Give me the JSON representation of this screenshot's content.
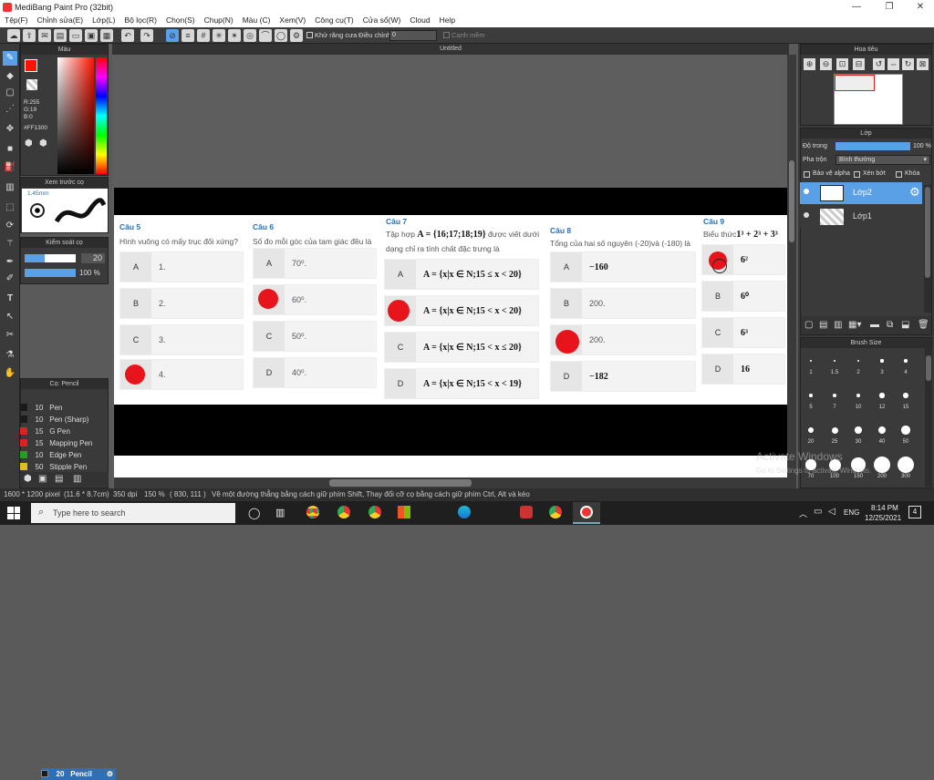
{
  "window": {
    "title": "MediBang Paint Pro (32bit)",
    "min": "—",
    "max": "❐",
    "close": "✕"
  },
  "menu": [
    "Tệp(F)",
    "Chỉnh sửa(E)",
    "Lớp(L)",
    "Bộ lọc(R)",
    "Chọn(S)",
    "Chụp(N)",
    "Màu (C)",
    "Xem(V)",
    "Công cụ(T)",
    "Cửa sổ(W)",
    "Cloud",
    "Help"
  ],
  "toolbar": {
    "antialias_label": "Khử răng cưa",
    "correction_label": "Điều chỉnh",
    "correction_value": "0",
    "snap_label": "Cạnh mềm"
  },
  "color_panel": {
    "title": "Màu",
    "r": "R:255",
    "g": "G:19",
    "b": "B:0",
    "hex": "#FF1300",
    "primary_color": "#ff1300"
  },
  "brush_preview": {
    "title": "Xem trước cọ",
    "size": "1.45mm"
  },
  "control_panel": {
    "title": "Kiểm soát cọ",
    "size": "20",
    "opacity": "100 %"
  },
  "brush_list": {
    "title": "Cọ: Pencil",
    "items": [
      {
        "size": "20",
        "name": "Pencil",
        "color": "#1a1a1a",
        "selected": true
      },
      {
        "size": "10",
        "name": "Pen",
        "color": "#1a1a1a"
      },
      {
        "size": "10",
        "name": "Pen (Sharp)",
        "color": "#1a1a1a"
      },
      {
        "size": "15",
        "name": "G Pen",
        "color": "#e02020"
      },
      {
        "size": "15",
        "name": "Mapping Pen",
        "color": "#e02020"
      },
      {
        "size": "10",
        "name": "Edge Pen",
        "color": "#20a020"
      },
      {
        "size": "50",
        "name": "Stipple Pen",
        "color": "#e0c020"
      }
    ]
  },
  "canvas": {
    "tab_title": "Untitled"
  },
  "questions": [
    {
      "head": "Câu 5",
      "text": "Hình vuông có mấy trục đối xứng?",
      "options": [
        [
          "A",
          "1."
        ],
        [
          "B",
          "2."
        ],
        [
          "C",
          "3."
        ],
        [
          "D",
          "4."
        ]
      ]
    },
    {
      "head": "Câu 6",
      "text": "Số đo mỗi góc của tam giác đều là",
      "options": [
        [
          "A",
          "70⁰."
        ],
        [
          "B",
          "60⁰."
        ],
        [
          "C",
          "50⁰."
        ],
        [
          "D",
          "40⁰."
        ]
      ]
    },
    {
      "head": "Câu 7",
      "text_a": "Tập hợp",
      "text_math": "A = {16;17;18;19}",
      "text_b": "được viết dưới",
      "text_c": "dạng chỉ ra tính chất đặc trưng là",
      "options": [
        [
          "A",
          "A = {x|x ∈ N;15 ≤ x < 20}"
        ],
        [
          "B",
          "A = {x|x ∈ N;15 < x < 20}"
        ],
        [
          "C",
          "A = {x|x ∈ N;15 < x ≤ 20}"
        ],
        [
          "D",
          "A = {x|x ∈ N;15 < x < 19}"
        ]
      ]
    },
    {
      "head": "Câu 8",
      "text": "Tổng của hai số nguyên (-20)và (-180) là",
      "options": [
        [
          "A",
          "−160"
        ],
        [
          "B",
          "200."
        ],
        [
          "C",
          "200."
        ],
        [
          "D",
          "−182"
        ]
      ]
    },
    {
      "head": "Câu 9",
      "text_a": "Biểu thức",
      "text_math": "1³ + 2³ + 3³",
      "options": [
        [
          "A",
          "6²"
        ],
        [
          "B",
          "6⁰"
        ],
        [
          "C",
          "6³"
        ],
        [
          "D",
          "16"
        ]
      ]
    }
  ],
  "navigator": {
    "title": "Hoa tiêu"
  },
  "layers": {
    "title": "Lớp",
    "opacity_label": "Độ trong",
    "opacity_value": "100 %",
    "blend_label": "Pha trộn",
    "blend_value": "Bình thường",
    "protect_alpha": "Bảo vệ alpha",
    "clipping": "Xén bớt",
    "lock": "Khóa",
    "items": [
      {
        "name": "Lớp2",
        "selected": true
      },
      {
        "name": "Lớp1",
        "selected": false
      }
    ]
  },
  "brush_size": {
    "title": "Brush Size",
    "labels": [
      "1",
      "1.5",
      "2",
      "3",
      "4",
      "5",
      "7",
      "10",
      "12",
      "15",
      "20",
      "25",
      "30",
      "40",
      "50",
      "70",
      "100",
      "150",
      "200",
      "300"
    ]
  },
  "watermark": {
    "line1": "Activate Windows",
    "line2": "Go to Settings to activate Windows."
  },
  "status": {
    "size": "1600 * 1200 pixel",
    "cm": "(11.6 * 8.7cm)",
    "dpi": "350 dpi",
    "zoom": "150 %",
    "coords": "( 830, 111 )",
    "hint": "Vẽ một đường thẳng bằng cách giữ phím Shift, Thay đổi cỡ cọ bằng cách giữ phím Ctrl, Alt và kéo"
  },
  "taskbar": {
    "search": "Type here to search",
    "lang": "ENG",
    "time": "8:14 PM",
    "date": "12/25/2021",
    "notif": "4"
  }
}
